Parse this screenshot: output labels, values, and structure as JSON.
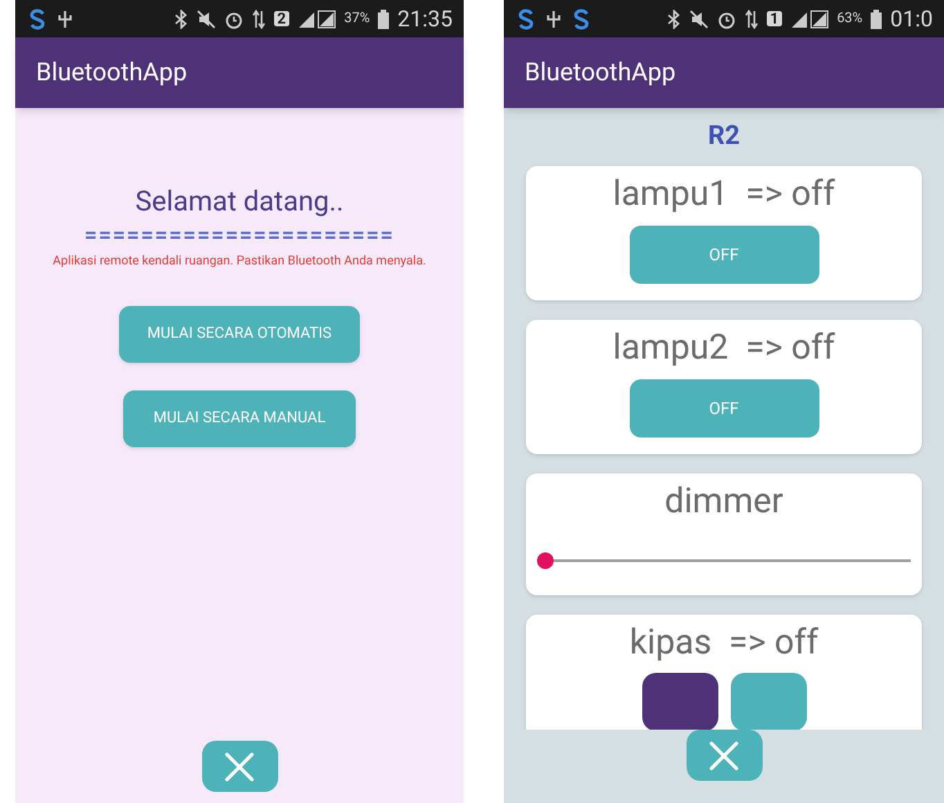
{
  "left_screen": {
    "status_bar": {
      "sim": "2",
      "battery": "37%",
      "time": "21:35"
    },
    "app_bar": {
      "title": "BluetoothApp"
    },
    "welcome": {
      "title": "Selamat datang..",
      "divider": "======================",
      "message": "Aplikasi remote kendali ruangan. Pastikan Bluetooth Anda menyala."
    },
    "buttons": [
      "MULAI SECARA OTOMATIS",
      "MULAI SECARA MANUAL"
    ]
  },
  "right_screen": {
    "status_bar": {
      "sim": "1",
      "battery": "63%",
      "time": "01:0"
    },
    "app_bar": {
      "title": "BluetoothApp"
    },
    "room": "R2",
    "controls": [
      {
        "kind": "switch",
        "label": "lampu1  => off",
        "button": "OFF"
      },
      {
        "kind": "switch",
        "label": "lampu2  => off",
        "button": "OFF"
      },
      {
        "kind": "slider",
        "label": "dimmer",
        "level": 0
      },
      {
        "kind": "toggle",
        "label": "kipas  => off",
        "buttons": [
          {
            "selected": true
          },
          {
            "selected": false
          }
        ]
      }
    ]
  }
}
